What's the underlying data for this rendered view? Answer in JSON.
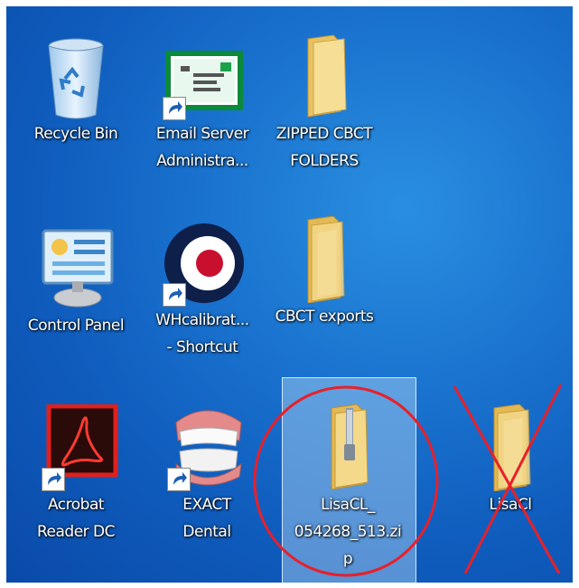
{
  "desktop": {
    "icons": [
      {
        "label": "Recycle Bin",
        "label2": ""
      },
      {
        "label": "Email Server",
        "label2": "Administra..."
      },
      {
        "label": "ZIPPED CBCT",
        "label2": "FOLDERS"
      },
      {
        "label": "Control Panel",
        "label2": ""
      },
      {
        "label": "WHcalibrat...",
        "label2": "- Shortcut"
      },
      {
        "label": "CBCT exports",
        "label2": ""
      },
      {
        "label": "Acrobat",
        "label2": "Reader DC"
      },
      {
        "label": "EXACT",
        "label2": "Dental"
      },
      {
        "label": "LisaCL_",
        "label2": "054268_513.zi",
        "label3": "p"
      },
      {
        "label": "LisaCl",
        "label2": ""
      }
    ]
  },
  "colors": {
    "annotation": "#e8202a",
    "folder": "#f2d27a",
    "selection": "#b4d7f5"
  }
}
